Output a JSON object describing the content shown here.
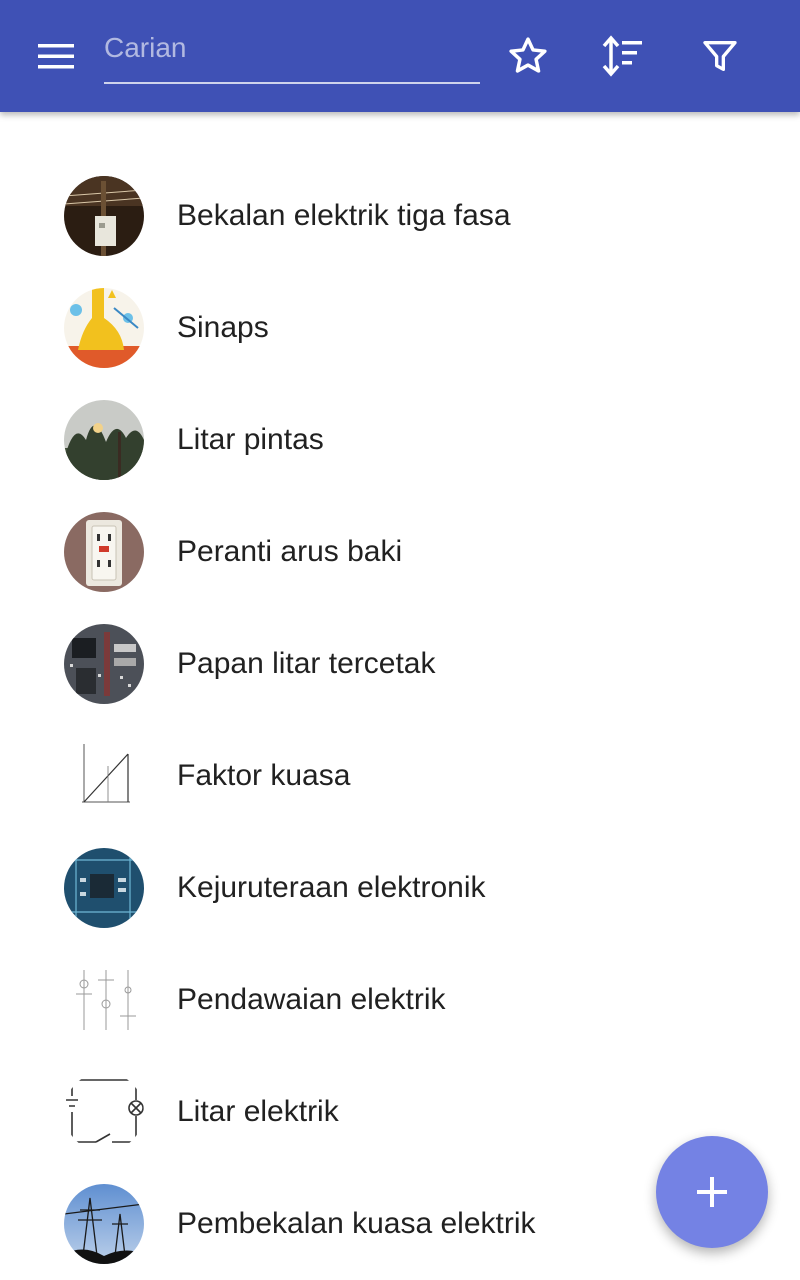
{
  "toolbar": {
    "search": {
      "placeholder": "Carian",
      "value": ""
    },
    "icons": {
      "menu": "hamburger-menu-icon",
      "favorites": "star-outline-icon",
      "sort": "sort-icon",
      "filter": "filter-icon"
    },
    "background_color": "#3f51b5"
  },
  "list": {
    "items": [
      {
        "title": "Bekalan elektrik tiga fasa",
        "thumbnail": "utility-pole-photo"
      },
      {
        "title": "Sinaps",
        "thumbnail": "synapse-diagram"
      },
      {
        "title": "Litar pintas",
        "thumbnail": "short-circuit-spark-photo"
      },
      {
        "title": "Peranti arus baki",
        "thumbnail": "gfci-outlet-photo"
      },
      {
        "title": "Papan litar tercetak",
        "thumbnail": "pcb-photo"
      },
      {
        "title": "Faktor kuasa",
        "thumbnail": "power-triangle-diagram"
      },
      {
        "title": "Kejuruteraan elektronik",
        "thumbnail": "circuit-board-photo"
      },
      {
        "title": "Pendawaian elektrik",
        "thumbnail": "wiring-symbols-diagram"
      },
      {
        "title": "Litar elektrik",
        "thumbnail": "simple-circuit-diagram"
      },
      {
        "title": "Pembekalan kuasa elektrik",
        "thumbnail": "transmission-tower-photo"
      }
    ]
  },
  "fab": {
    "icon": "plus-icon",
    "color": "#7482e4"
  }
}
